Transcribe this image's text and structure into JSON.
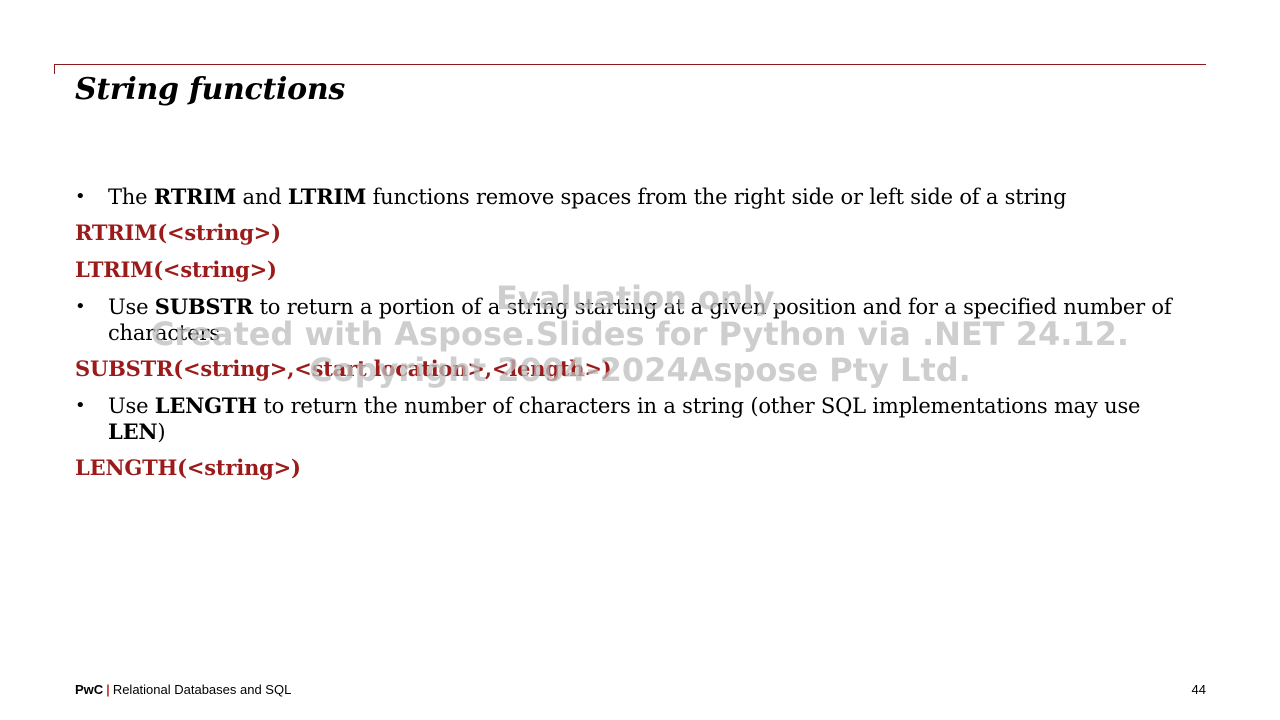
{
  "slide": {
    "title": "String functions"
  },
  "bullets": [
    {
      "parts": [
        "The ",
        "RTRIM",
        " and ",
        "LTRIM",
        " functions remove spaces from the right side or left side of a string"
      ]
    },
    {
      "parts": [
        "Use ",
        "SUBSTR",
        " to return a portion of a string starting at a given position and for a specified number of characters"
      ]
    },
    {
      "parts": [
        "Use ",
        "LENGTH",
        " to return the number of characters in a string (other SQL implementations may use ",
        "LEN",
        ")"
      ]
    }
  ],
  "syntax": {
    "rtrim": "RTRIM(<string>)",
    "ltrim": "LTRIM(<string>)",
    "substr": "SUBSTR(<string>,<start location>,<length>)",
    "length": "LENGTH(<string>)"
  },
  "watermark": {
    "line1": "Evaluation only.",
    "line2": "Created with Aspose.Slides for Python via .NET 24.12.",
    "line3": "Copyright 2004-2024Aspose Pty Ltd."
  },
  "footer": {
    "brand": "PwC",
    "separator": "|",
    "text": "Relational Databases and SQL",
    "page_number": "44"
  },
  "colors": {
    "accent": "#9b1b1b",
    "rule": "#8b1a1a"
  }
}
